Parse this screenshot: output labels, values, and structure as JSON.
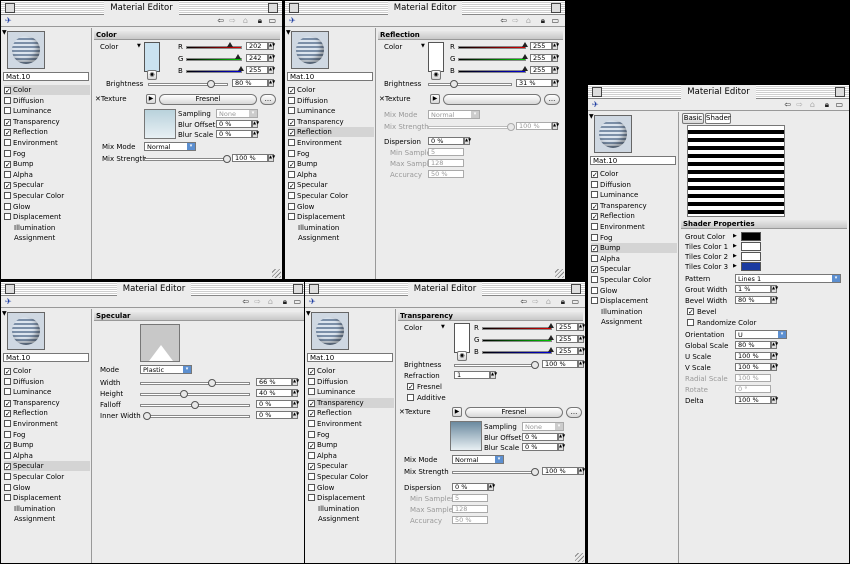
{
  "window_title": "Material Editor",
  "material_name": "Mat.10",
  "channels": [
    {
      "label": "Color",
      "checked": true
    },
    {
      "label": "Diffusion",
      "checked": false
    },
    {
      "label": "Luminance",
      "checked": false
    },
    {
      "label": "Transparency",
      "checked": true
    },
    {
      "label": "Reflection",
      "checked": true
    },
    {
      "label": "Environment",
      "checked": false
    },
    {
      "label": "Fog",
      "checked": false
    },
    {
      "label": "Bump",
      "checked": true
    },
    {
      "label": "Alpha",
      "checked": false
    },
    {
      "label": "Specular",
      "checked": true
    },
    {
      "label": "Specular Color",
      "checked": false
    },
    {
      "label": "Glow",
      "checked": false
    },
    {
      "label": "Displacement",
      "checked": false
    },
    {
      "label": "Illumination",
      "checked": null
    },
    {
      "label": "Assignment",
      "checked": null
    }
  ],
  "color_panel": {
    "header": "Color",
    "color_label": "Color",
    "r_label": "R",
    "r_value": "202",
    "g_label": "G",
    "g_value": "242",
    "b_label": "B",
    "b_value": "255",
    "brightness_label": "Brightness",
    "brightness_value": "80 %",
    "texture_label": "Texture",
    "texture_name": "Fresnel",
    "sampling_label": "Sampling",
    "sampling_value": "None",
    "blur_offset_label": "Blur Offset",
    "blur_offset_value": "0 %",
    "blur_scale_label": "Blur Scale",
    "blur_scale_value": "0 %",
    "mix_mode_label": "Mix Mode",
    "mix_mode_value": "Normal",
    "mix_strength_label": "Mix Strength",
    "mix_strength_value": "100 %",
    "swatch": "#cae2f0"
  },
  "reflection_panel": {
    "header": "Reflection",
    "color_label": "Color",
    "r_label": "R",
    "r_value": "255",
    "g_label": "G",
    "g_value": "255",
    "b_label": "B",
    "b_value": "255",
    "brightness_label": "Brightness",
    "brightness_value": "31 %",
    "texture_label": "Texture",
    "mix_mode_label": "Mix Mode",
    "mix_mode_value": "Normal",
    "mix_strength_label": "Mix Strength",
    "mix_strength_value": "100 %",
    "dispersion_label": "Dispersion",
    "dispersion_value": "0 %",
    "min_samples_label": "Min Samples",
    "min_samples_value": "5",
    "max_samples_label": "Max Samples",
    "max_samples_value": "128",
    "accuracy_label": "Accuracy",
    "accuracy_value": "50 %"
  },
  "specular_panel": {
    "header": "Specular",
    "mode_label": "Mode",
    "mode_value": "Plastic",
    "width_label": "Width",
    "width_value": "66 %",
    "height_label": "Height",
    "height_value": "40 %",
    "falloff_label": "Falloff",
    "falloff_value": "0 %",
    "inner_width_label": "Inner Width",
    "inner_width_value": "0 %"
  },
  "transparency_panel": {
    "header": "Transparency",
    "color_label": "Color",
    "r_label": "R",
    "r_value": "255",
    "g_label": "G",
    "g_value": "255",
    "b_label": "B",
    "b_value": "255",
    "brightness_label": "Brightness",
    "brightness_value": "100 %",
    "refraction_label": "Refraction",
    "refraction_value": "1",
    "fresnel_label": "Fresnel",
    "additive_label": "Additive",
    "texture_label": "Texture",
    "texture_name": "Fresnel",
    "sampling_label": "Sampling",
    "sampling_value": "None",
    "blur_offset_label": "Blur Offset",
    "blur_offset_value": "0 %",
    "blur_scale_label": "Blur Scale",
    "blur_scale_value": "0 %",
    "mix_mode_label": "Mix Mode",
    "mix_mode_value": "Normal",
    "mix_strength_label": "Mix Strength",
    "mix_strength_value": "100 %",
    "dispersion_label": "Dispersion",
    "dispersion_value": "0 %",
    "min_samples_label": "Min Samples",
    "min_samples_value": "5",
    "max_samples_label": "Max Samples",
    "max_samples_value": "128",
    "accuracy_label": "Accuracy",
    "accuracy_value": "50 %"
  },
  "bump_panel": {
    "tab_basic": "Basic",
    "tab_shader": "Shader",
    "header": "Shader Properties",
    "grout_color_label": "Grout Color",
    "tiles_color_1_label": "Tiles Color 1",
    "tiles_color_2_label": "Tiles Color 2",
    "tiles_color_3_label": "Tiles Color 3",
    "grout_color": "#000000",
    "tiles_color_1": "#ffffff",
    "tiles_color_2": "#ffffff",
    "tiles_color_3": "#1a3aa0",
    "pattern_label": "Pattern",
    "pattern_value": "Lines 1",
    "grout_width_label": "Grout Width",
    "grout_width_value": "1 %",
    "bevel_width_label": "Bevel Width",
    "bevel_width_value": "80 %",
    "bevel_label": "Bevel",
    "randomize_label": "Randomize Color",
    "orientation_label": "Orientation",
    "orientation_value": "U",
    "global_scale_label": "Global Scale",
    "global_scale_value": "80 %",
    "uscale_label": "U Scale",
    "uscale_value": "100 %",
    "vscale_label": "V Scale",
    "vscale_value": "100 %",
    "radial_scale_label": "Radial Scale",
    "radial_scale_value": "100 %",
    "rotate_label": "Rotate",
    "rotate_value": "0 °",
    "delta_label": "Delta",
    "delta_value": "100 %"
  }
}
